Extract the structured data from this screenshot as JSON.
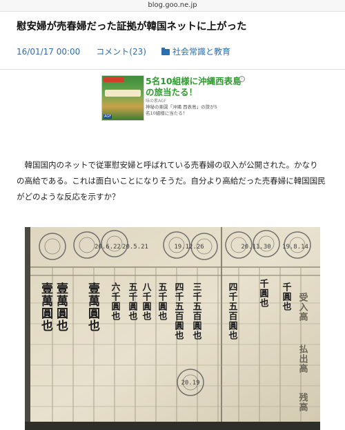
{
  "browser": {
    "url": "blog.goo.ne.jp"
  },
  "article": {
    "title": "慰安婦が売春婦だった証拠が韓国ネットに上がった",
    "date": "16/01/17 00:00",
    "comments": "コメント(23)",
    "category": "社会常識と教育",
    "body": "　韓国国内のネットで従軍慰安婦と呼ばれている売春婦の収入が公開された。かなりの高給である。これは面白いことになりそうだ。自分より高給だった売春婦に韓国国民がどのような反応を示すか？"
  },
  "ad": {
    "headline": "5名10組様に沖縄西表島の旅当たる！",
    "sponsor": "味の素AGF",
    "description": "神秘の楽園「沖縄 西表島」の旅が5名10組様に当たる！",
    "image_banner": "沖縄 西表島の旅",
    "image_brand": "AGF",
    "info_icon": "info-icon"
  },
  "photo": {
    "stamps": [
      "20.6.22",
      "20.5.21",
      "19.12.26",
      "20.11.30",
      "19.8.14",
      "20.19"
    ],
    "columns": [
      "壹萬圓也",
      "壹萬圓也",
      "壹萬圓也",
      "六千圓也",
      "五千圓也",
      "八千圓也",
      "五千圓也",
      "四千五百圓也",
      "三千五百圓也",
      "四千五百圓也",
      "千圓也",
      "千圓也",
      "受入高",
      "払出高",
      "残高"
    ]
  }
}
